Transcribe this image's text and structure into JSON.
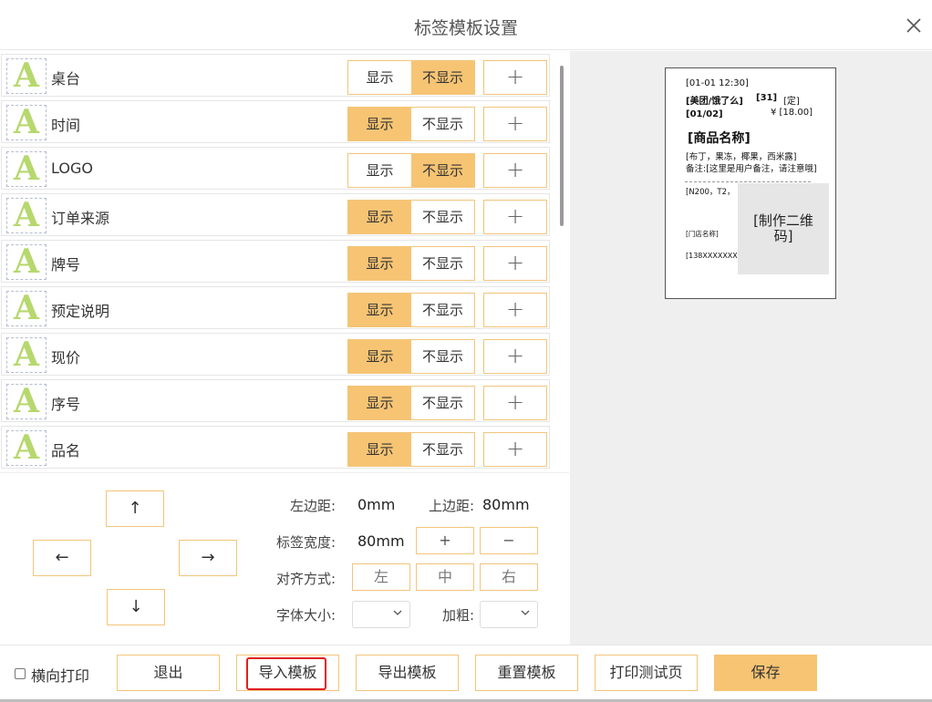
{
  "window": {
    "title": "标签模板设置"
  },
  "fields": [
    {
      "label": "桌台",
      "show": false
    },
    {
      "label": "时间",
      "show": true
    },
    {
      "label": "LOGO",
      "show": false
    },
    {
      "label": "订单来源",
      "show": true
    },
    {
      "label": "牌号",
      "show": true
    },
    {
      "label": "预定说明",
      "show": true
    },
    {
      "label": "现价",
      "show": true
    },
    {
      "label": "序号",
      "show": true
    },
    {
      "label": "品名",
      "show": true
    }
  ],
  "toggle": {
    "show_label": "显示",
    "hide_label": "不显示",
    "plus_label": "+"
  },
  "field_icon_glyph": "A",
  "preview": {
    "line1": "[01-01 12:30]",
    "line2a": "[美团/饿了么]",
    "line2b": "[31]",
    "line2c": "[定]",
    "line3a": "[01/02]",
    "line3b": "¥ [18.00]",
    "product": "[商品名称]",
    "toppings": "[布丁，果冻，椰果，西米露]",
    "note": "备注:[这里是用户备注，请注意哦]",
    "code": "[N200，T2，",
    "store": "[门店名称]",
    "phone": "[138XXXXXXXX",
    "qr_text": "[制作二维码]"
  },
  "arrows": {
    "up": "↑",
    "down": "↓",
    "left": "←",
    "right": "→"
  },
  "settings": {
    "left_margin_label": "左边距:",
    "left_margin_value": "0mm",
    "top_margin_label": "上边距:",
    "top_margin_value": "80mm",
    "width_label": "标签宽度:",
    "width_value": "80mm",
    "width_plus": "+",
    "width_minus": "−",
    "align_label": "对齐方式:",
    "align_left": "左",
    "align_center": "中",
    "align_right": "右",
    "font_size_label": "字体大小:",
    "bold_label": "加粗:"
  },
  "footer": {
    "landscape_label": "横向打印",
    "exit": "退出",
    "import": "导入模板",
    "export": "导出模板",
    "reset": "重置模板",
    "test_print": "打印测试页",
    "save": "保存"
  },
  "colors": {
    "accent": "#f7c473",
    "accent_border": "#f2c57a",
    "highlight": "#e02020",
    "icon_green": "#b6d86e"
  },
  "icons": {
    "close": "close-icon",
    "chevron": "chevron-down-icon",
    "field": "letter-a-icon"
  }
}
